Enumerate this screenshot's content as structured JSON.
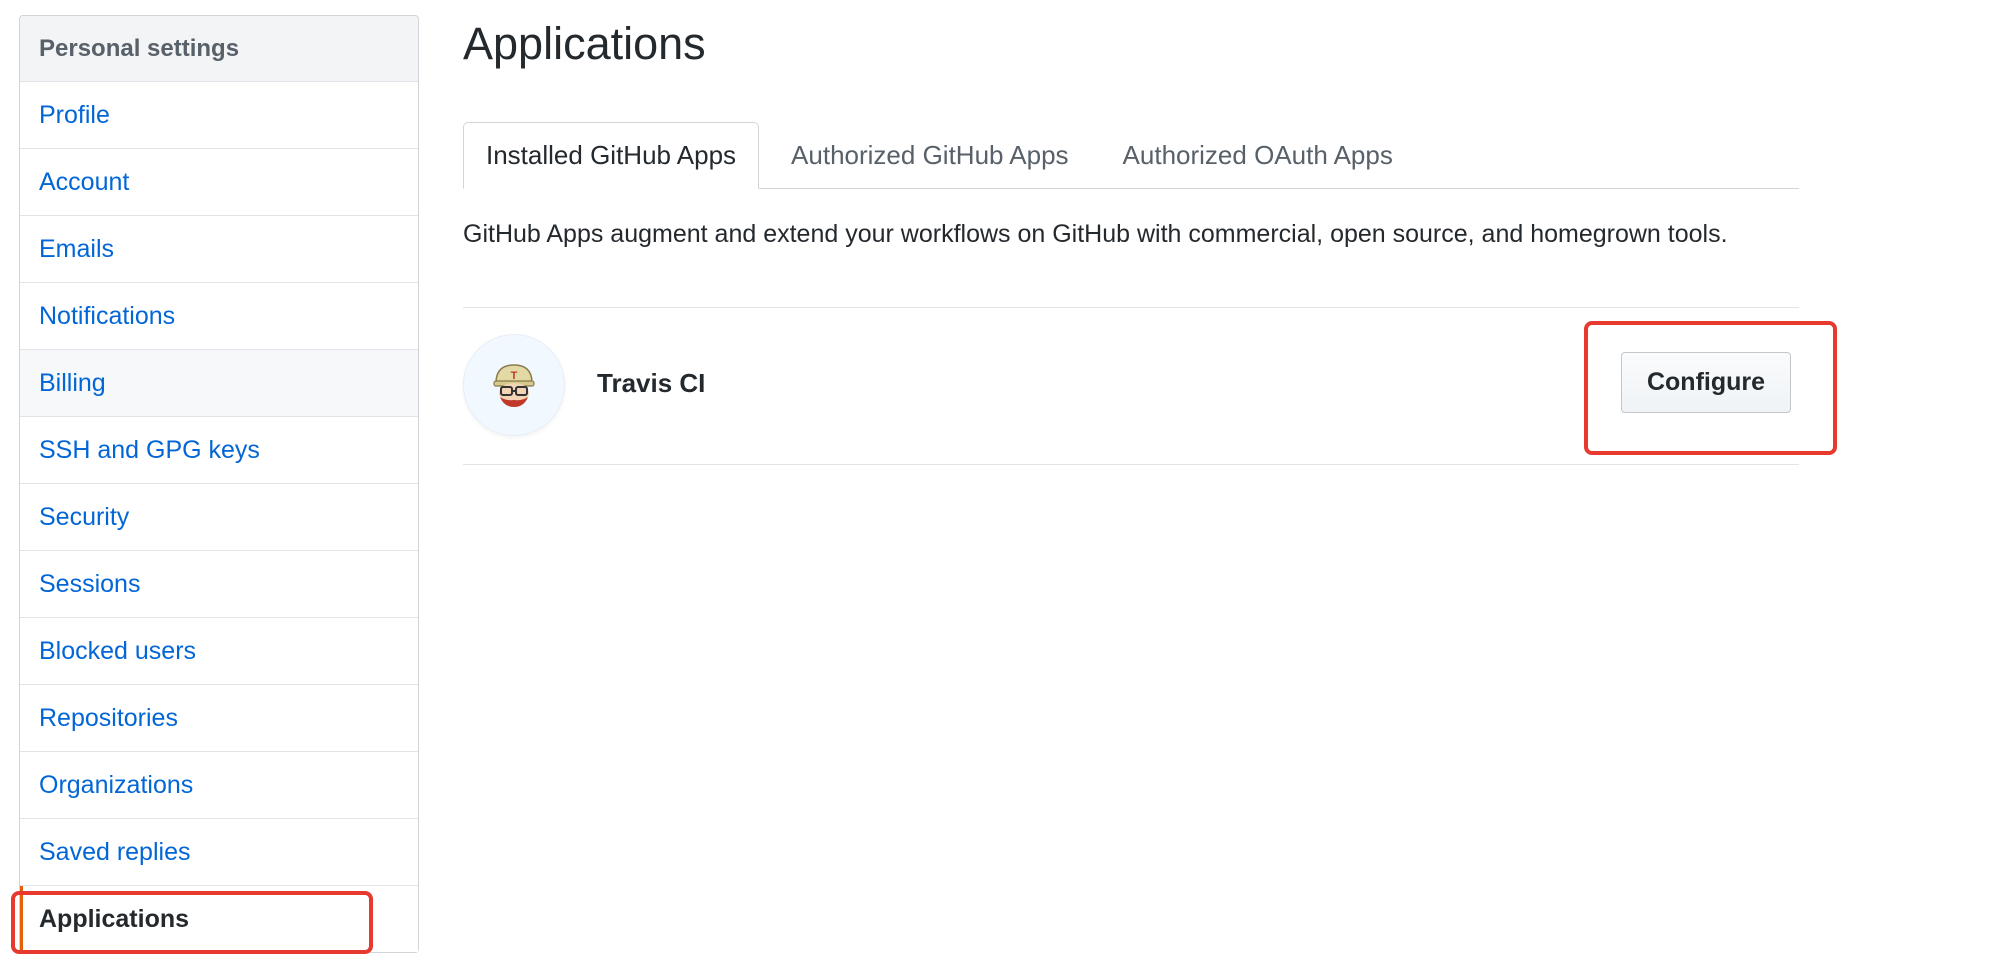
{
  "sidebar": {
    "header": "Personal settings",
    "items": [
      {
        "label": "Profile"
      },
      {
        "label": "Account"
      },
      {
        "label": "Emails"
      },
      {
        "label": "Notifications"
      },
      {
        "label": "Billing"
      },
      {
        "label": "SSH and GPG keys"
      },
      {
        "label": "Security"
      },
      {
        "label": "Sessions"
      },
      {
        "label": "Blocked users"
      },
      {
        "label": "Repositories"
      },
      {
        "label": "Organizations"
      },
      {
        "label": "Saved replies"
      },
      {
        "label": "Applications"
      }
    ],
    "selected": "Applications"
  },
  "main": {
    "title": "Applications",
    "tabs": [
      {
        "label": "Installed GitHub Apps",
        "active": true
      },
      {
        "label": "Authorized GitHub Apps",
        "active": false
      },
      {
        "label": "Authorized OAuth Apps",
        "active": false
      }
    ],
    "description": "GitHub Apps augment and extend your workflows on GitHub with commercial, open source, and homegrown tools.",
    "apps": [
      {
        "name": "Travis CI",
        "icon": "travis-ci-mascot-icon",
        "action_label": "Configure"
      }
    ]
  },
  "colors": {
    "link": "#0366d6",
    "selected_marker": "#e36209",
    "annotation": "#e8392f"
  }
}
